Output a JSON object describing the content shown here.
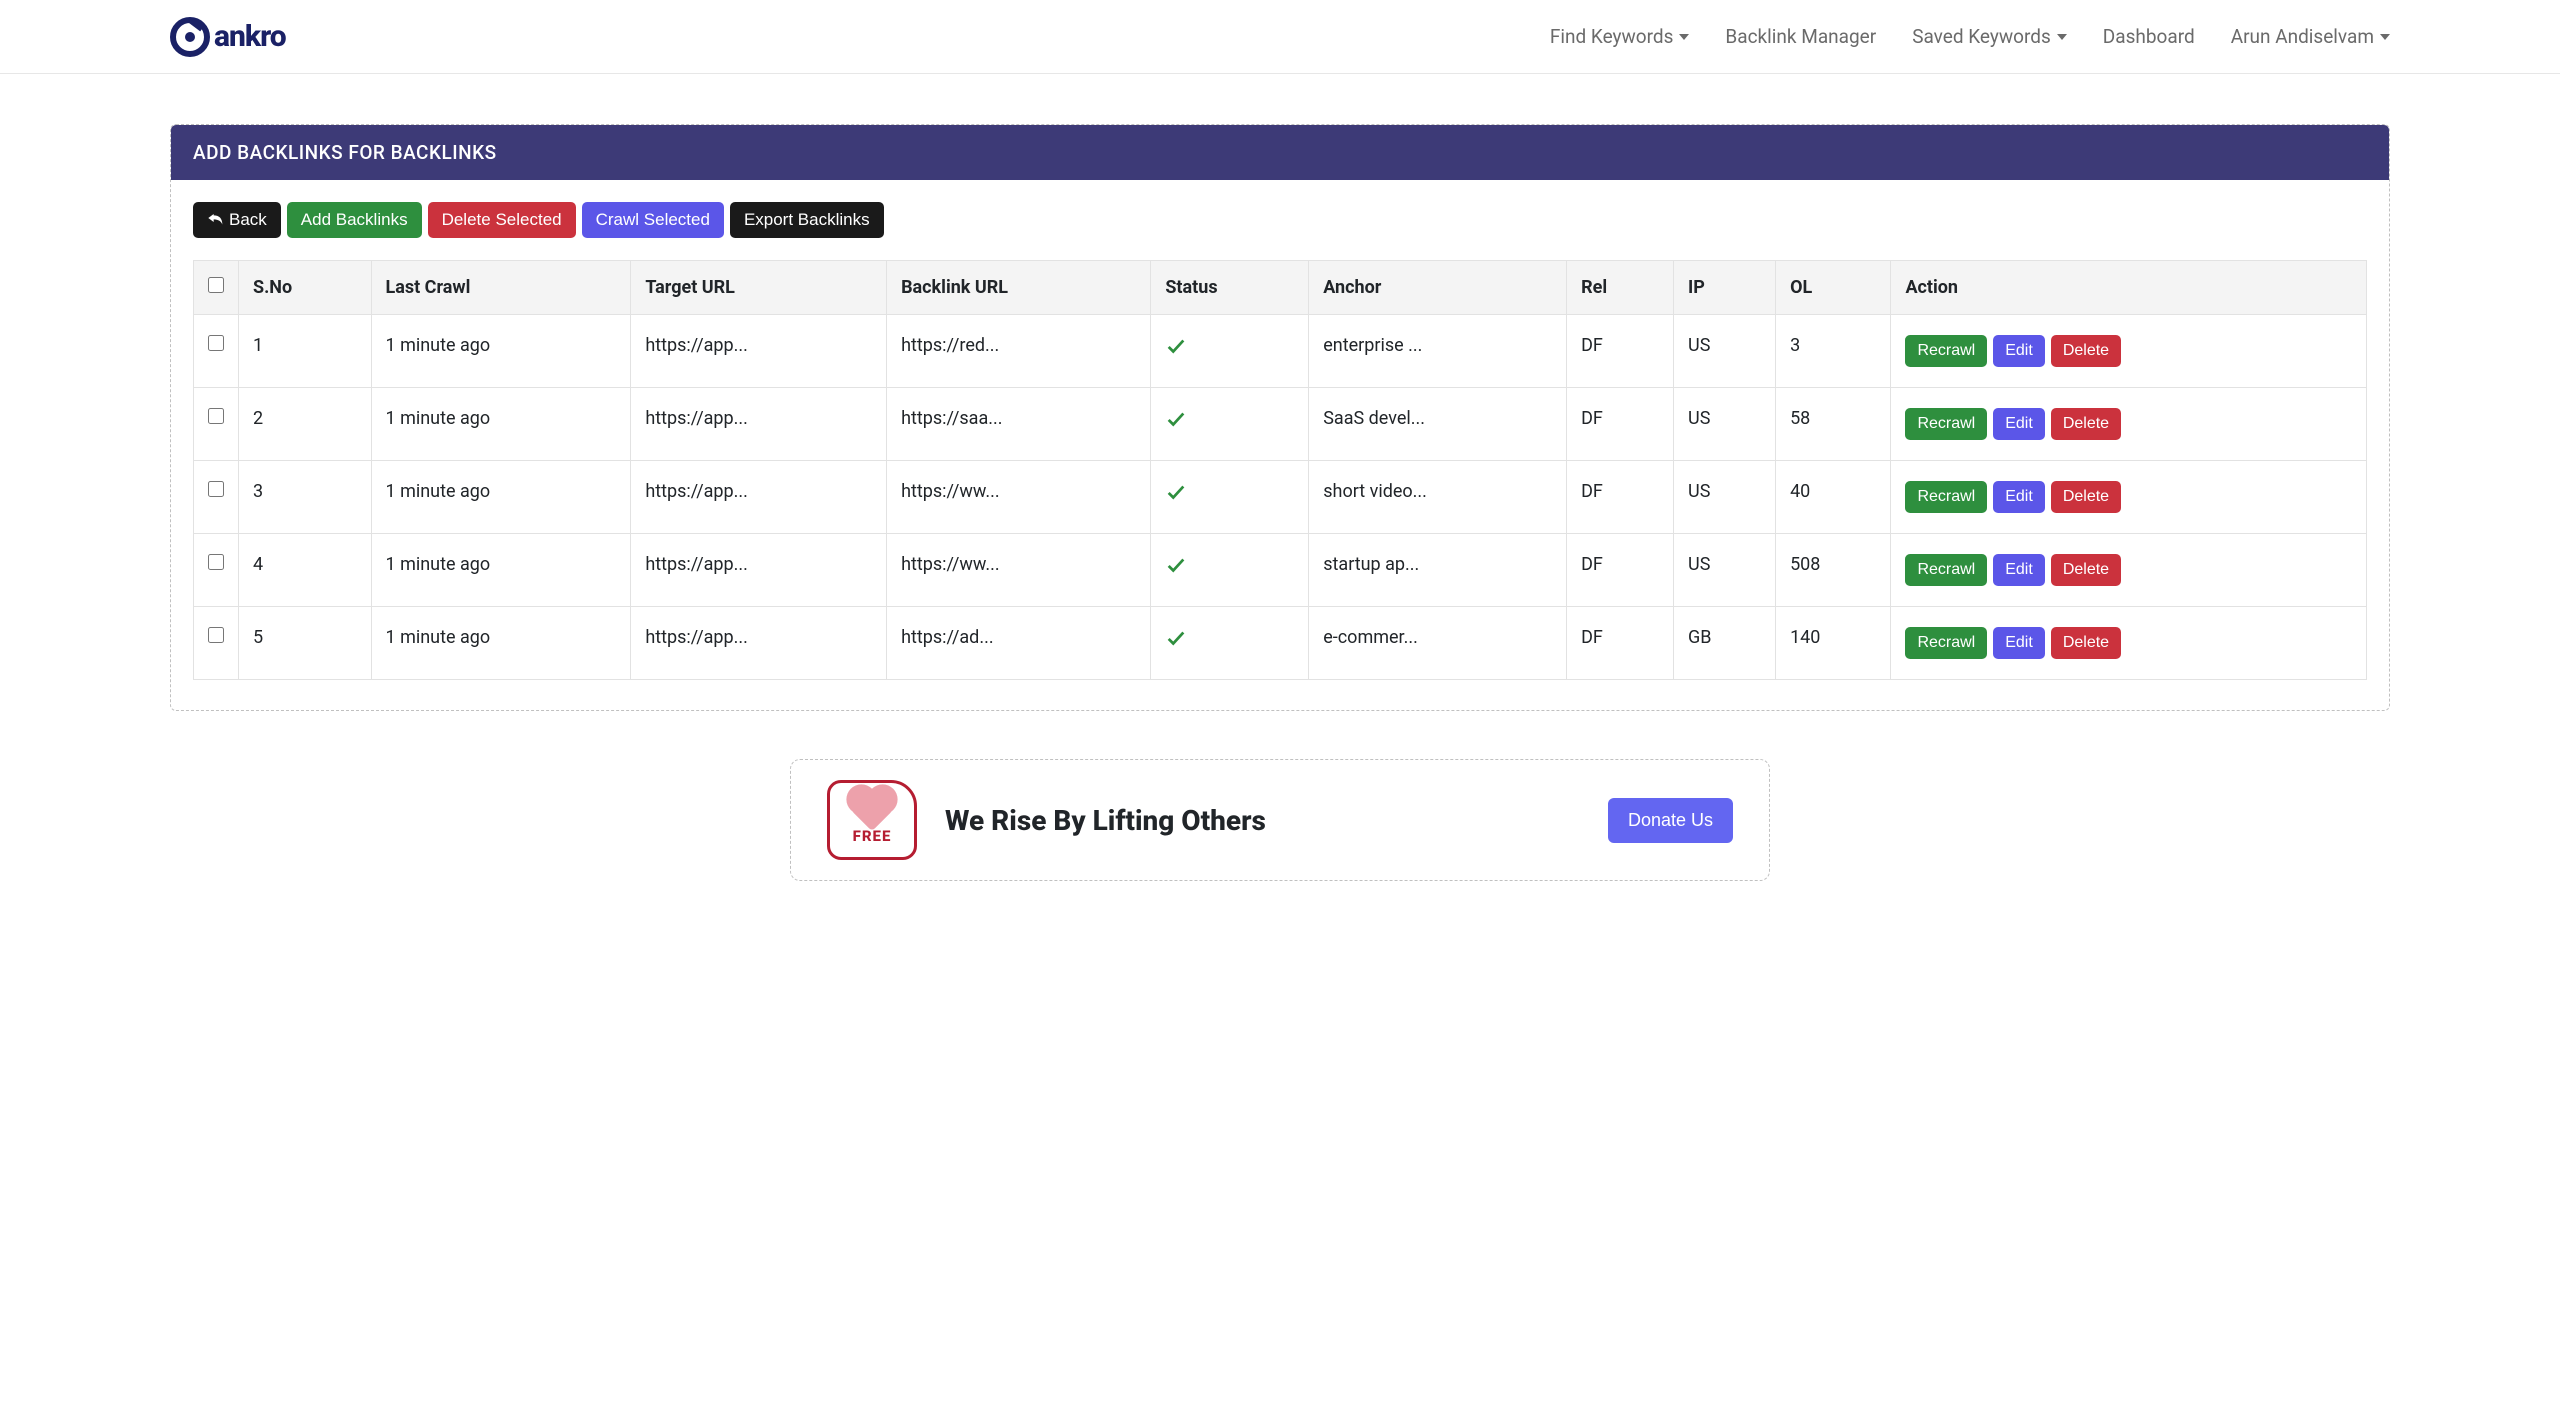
{
  "brand": "ankro",
  "nav": [
    {
      "label": "Find Keywords",
      "hasCaret": true
    },
    {
      "label": "Backlink Manager",
      "hasCaret": false
    },
    {
      "label": "Saved Keywords",
      "hasCaret": true
    },
    {
      "label": "Dashboard",
      "hasCaret": false
    },
    {
      "label": "Arun Andiselvam",
      "hasCaret": true
    }
  ],
  "card": {
    "title": "ADD BACKLINKS FOR BACKLINKS",
    "buttons": {
      "back": "Back",
      "add": "Add Backlinks",
      "deleteSel": "Delete Selected",
      "crawlSel": "Crawl Selected",
      "export": "Export Backlinks"
    }
  },
  "table": {
    "headers": [
      "S.No",
      "Last Crawl",
      "Target URL",
      "Backlink URL",
      "Status",
      "Anchor",
      "Rel",
      "IP",
      "OL",
      "Action"
    ],
    "actions": {
      "recrawl": "Recrawl",
      "edit": "Edit",
      "delete": "Delete"
    },
    "rows": [
      {
        "sno": "1",
        "lastCrawl": "1 minute ago",
        "target": "https://app...",
        "backlink": "https://red...",
        "anchor": "enterprise ...",
        "rel": "DF",
        "ip": "US",
        "ol": "3"
      },
      {
        "sno": "2",
        "lastCrawl": "1 minute ago",
        "target": "https://app...",
        "backlink": "https://saa...",
        "anchor": "SaaS devel...",
        "rel": "DF",
        "ip": "US",
        "ol": "58"
      },
      {
        "sno": "3",
        "lastCrawl": "1 minute ago",
        "target": "https://app...",
        "backlink": "https://ww...",
        "anchor": "short video...",
        "rel": "DF",
        "ip": "US",
        "ol": "40"
      },
      {
        "sno": "4",
        "lastCrawl": "1 minute ago",
        "target": "https://app...",
        "backlink": "https://ww...",
        "anchor": "startup ap...",
        "rel": "DF",
        "ip": "US",
        "ol": "508"
      },
      {
        "sno": "5",
        "lastCrawl": "1 minute ago",
        "target": "https://app...",
        "backlink": "https://ad...",
        "anchor": "e-commer...",
        "rel": "DF",
        "ip": "GB",
        "ol": "140"
      }
    ]
  },
  "donate": {
    "badge": "FREE",
    "title": "We Rise By Lifting Others",
    "button": "Donate Us"
  }
}
